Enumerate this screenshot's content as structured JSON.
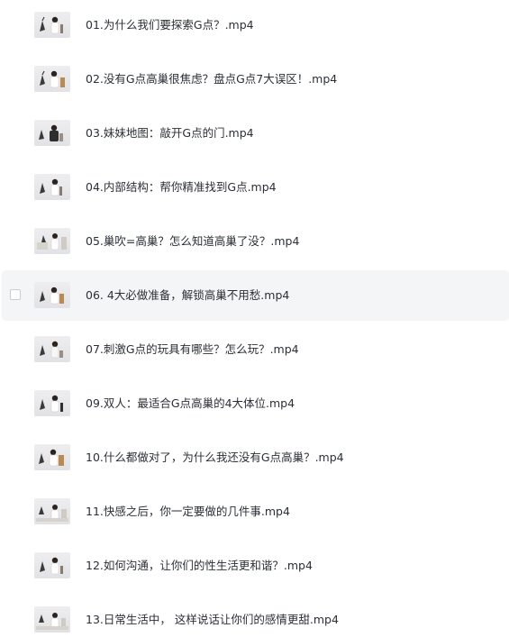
{
  "files": [
    {
      "name": "01.为什么我们要探索G点？.mp4",
      "thumbnail": "video-thumbnail"
    },
    {
      "name": "02.没有G点高巢很焦虑？盘点G点7大误区！.mp4",
      "thumbnail": "video-thumbnail"
    },
    {
      "name": "03.妹妹地图：敲开G点的门.mp4",
      "thumbnail": "video-thumbnail"
    },
    {
      "name": "04.内部结构：帮你精准找到G点.mp4",
      "thumbnail": "video-thumbnail"
    },
    {
      "name": "05.巢吹=高巢？怎么知道高巢了没？.mp4",
      "thumbnail": "video-thumbnail"
    },
    {
      "name": "06. 4大必做准备，解锁高巢不用愁.mp4",
      "thumbnail": "video-thumbnail",
      "hovered": true
    },
    {
      "name": "07.刺激G点的玩具有哪些？怎么玩？.mp4",
      "thumbnail": "video-thumbnail"
    },
    {
      "name": "09.双人：最适合G点高巢的4大体位.mp4",
      "thumbnail": "video-thumbnail"
    },
    {
      "name": "10.什么都做对了，为什么我还没有G点高巢？.mp4",
      "thumbnail": "video-thumbnail"
    },
    {
      "name": "11.快感之后，你一定要做的几件事.mp4",
      "thumbnail": "video-thumbnail"
    },
    {
      "name": "12.如何沟通，让你们的性生活更和谐？.mp4",
      "thumbnail": "video-thumbnail"
    },
    {
      "name": "13.日常生活中， 这样说话让你们的感情更甜.mp4",
      "thumbnail": "video-thumbnail"
    }
  ]
}
